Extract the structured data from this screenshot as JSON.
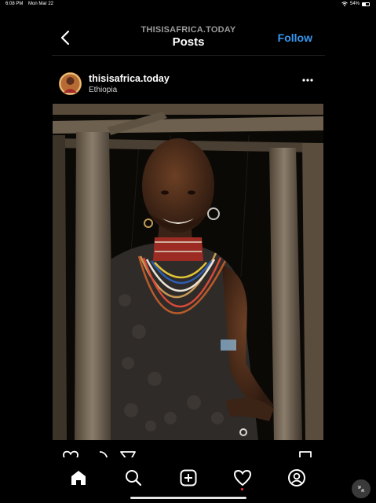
{
  "status_bar": {
    "time": "6:08 PM",
    "date": "Mon Mar 22",
    "battery": "54%",
    "battery_level": 0.54
  },
  "header": {
    "account": "THISISAFRICA.TODAY",
    "title": "Posts",
    "follow_label": "Follow"
  },
  "post": {
    "username": "thisisafrica.today",
    "location": "Ethiopia"
  },
  "tab_bar": {
    "items": [
      "home-icon",
      "search-icon",
      "new-post-icon",
      "activity-icon",
      "profile-icon"
    ]
  },
  "colors": {
    "background": "#000000",
    "accent": "#3897f0",
    "notification": "#ff3040"
  }
}
